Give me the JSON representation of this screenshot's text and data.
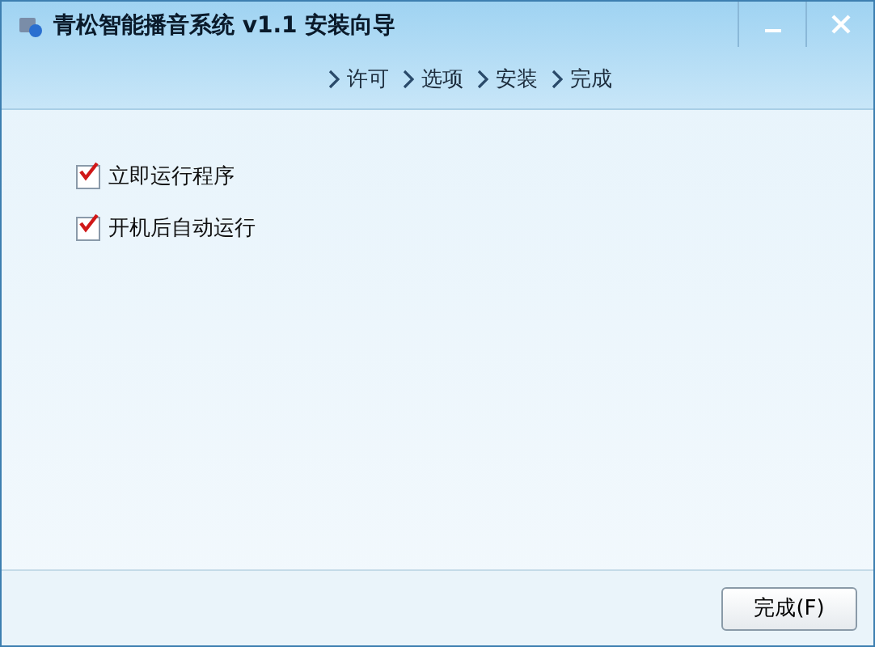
{
  "window": {
    "title": "青松智能播音系统 v1.1 安装向导"
  },
  "steps": [
    {
      "label": "许可"
    },
    {
      "label": "选项"
    },
    {
      "label": "安装"
    },
    {
      "label": "完成"
    }
  ],
  "options": [
    {
      "label": "立即运行程序",
      "checked": true
    },
    {
      "label": "开机后自动运行",
      "checked": true
    }
  ],
  "buttons": [
    "完成(F)"
  ]
}
